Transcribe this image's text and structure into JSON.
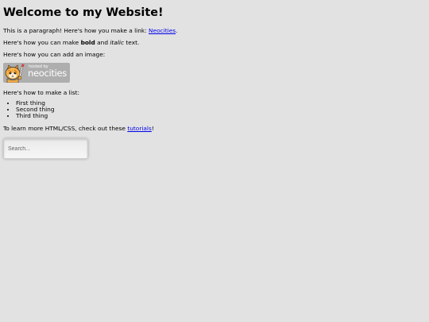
{
  "heading": "Welcome to my Website!",
  "paragraph_link": {
    "before": "This is a paragraph! Here's how you make a link: ",
    "link_text": "Neocities",
    "after": "."
  },
  "paragraph_format": {
    "before": "Here's how you can make ",
    "bold": "bold",
    "middle": " and ",
    "italic": "italic",
    "after": " text."
  },
  "paragraph_image": "Here's how you can add an image:",
  "badge": {
    "small_text": "hosted by",
    "big_text": "neocities"
  },
  "paragraph_list": "Here's how to make a list:",
  "list_items": [
    "First thing",
    "Second thing",
    "Third thing"
  ],
  "paragraph_tutorials": {
    "before": "To learn more HTML/CSS, check out these ",
    "link_text": "tutorials",
    "after": "!"
  },
  "search": {
    "placeholder": "Search..."
  },
  "colors": {
    "background": "#e2e2e2",
    "link": "#0000ee",
    "badge": "#aeaeae"
  },
  "icons": {
    "badge_mascot": "neocities-cat-icon"
  }
}
